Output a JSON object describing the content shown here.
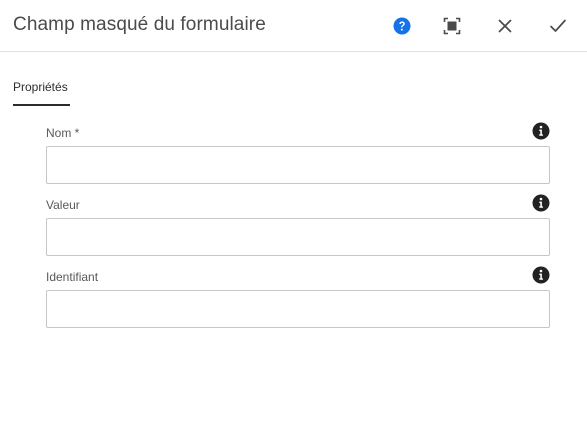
{
  "dialog": {
    "title": "Champ masqué du formulaire",
    "actions": {
      "help": "help-icon",
      "fullscreen": "fullscreen-icon",
      "close": "close-icon",
      "done": "checkmark-icon"
    }
  },
  "tabs": [
    {
      "label": "Propriétés",
      "active": true
    }
  ],
  "fields": [
    {
      "label": "Nom *",
      "value": "",
      "info_icon": "info-icon"
    },
    {
      "label": "Valeur",
      "value": "",
      "info_icon": "info-icon"
    },
    {
      "label": "Identifiant",
      "value": "",
      "info_icon": "info-icon"
    }
  ],
  "colors": {
    "help_blue": "#1473e6",
    "icon_dark": "#4b4b4b",
    "border": "#c6c6c6"
  }
}
